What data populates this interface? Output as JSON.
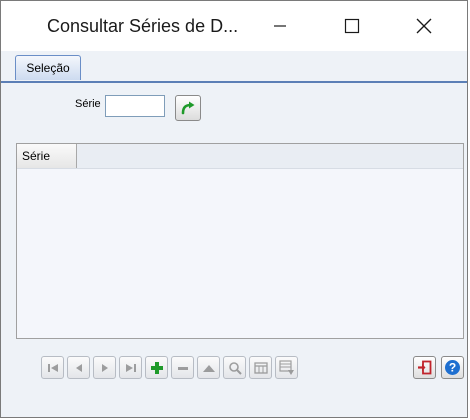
{
  "window": {
    "title": "Consultar Séries de D..."
  },
  "tabs": [
    {
      "label": "Seleção",
      "active": true
    }
  ],
  "filter": {
    "serie_label": "Série",
    "serie_value": ""
  },
  "grid": {
    "columns": [
      "Série"
    ],
    "rows": []
  },
  "navigator": {
    "buttons": [
      {
        "icon": "first-record-icon",
        "enabled": false
      },
      {
        "icon": "prev-record-icon",
        "enabled": false
      },
      {
        "icon": "next-record-icon",
        "enabled": false
      },
      {
        "icon": "last-record-icon",
        "enabled": false
      },
      {
        "icon": "add-record-icon",
        "enabled": true
      },
      {
        "icon": "delete-record-icon",
        "enabled": false
      },
      {
        "icon": "up-icon",
        "enabled": false
      },
      {
        "icon": "search-icon",
        "enabled": false
      },
      {
        "icon": "grid-view-icon",
        "enabled": false
      },
      {
        "icon": "export-icon",
        "enabled": false
      }
    ]
  },
  "colors": {
    "accent_border": "#5b7fb6",
    "add_green": "#1f9a2a",
    "exit_red": "#c0242c",
    "help_blue": "#1e6fd0"
  }
}
